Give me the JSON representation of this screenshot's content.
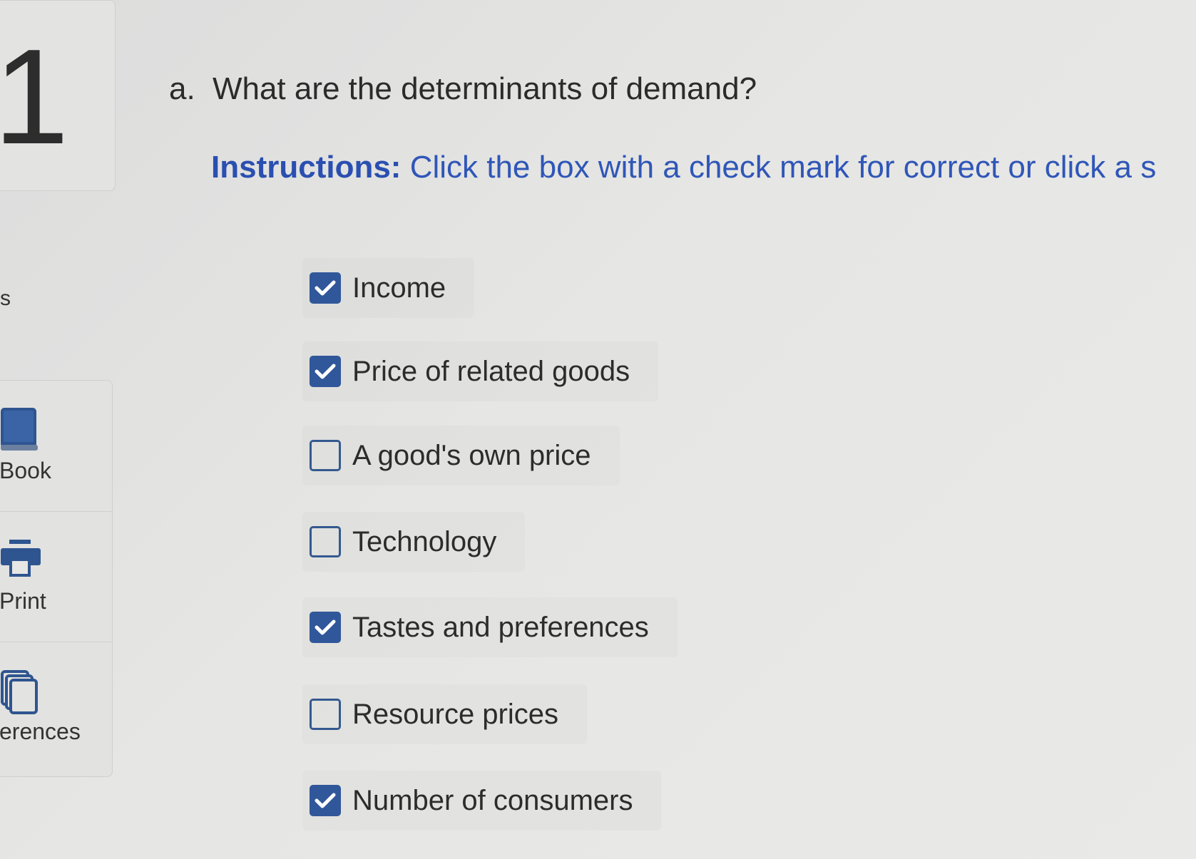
{
  "question": {
    "number": "1",
    "prefix": "a.",
    "text": "What are the determinants of demand?"
  },
  "instructions": {
    "label": "Instructions:",
    "text": "Click the box with a check mark for correct or click a s"
  },
  "options": [
    {
      "label": "Income",
      "checked": true
    },
    {
      "label": "Price of related goods",
      "checked": true
    },
    {
      "label": "A good's own price",
      "checked": false
    },
    {
      "label": "Technology",
      "checked": false
    },
    {
      "label": "Tastes and preferences",
      "checked": true
    },
    {
      "label": "Resource prices",
      "checked": false
    },
    {
      "label": "Number of consumers",
      "checked": true
    }
  ],
  "sidebar": {
    "partial_label": "s",
    "tools": [
      {
        "label": "Book",
        "icon": "book-icon"
      },
      {
        "label": "Print",
        "icon": "print-icon"
      },
      {
        "label": "erences",
        "icon": "references-icon"
      }
    ]
  },
  "colors": {
    "accent": "#30579a",
    "instructions": "#2f56b8",
    "background": "#e6e6e4"
  }
}
